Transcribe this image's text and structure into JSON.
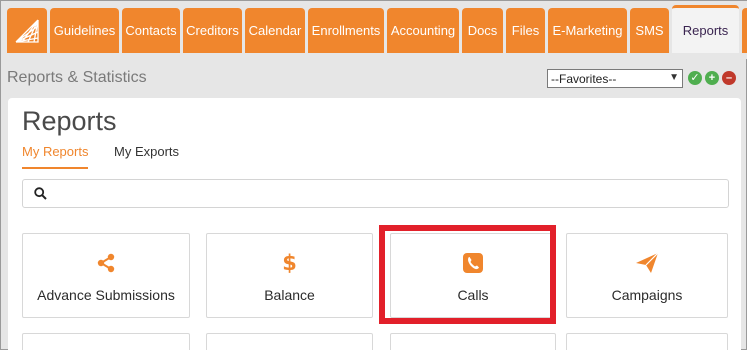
{
  "nav": {
    "tabs": [
      {
        "label": "Guidelines"
      },
      {
        "label": "Contacts"
      },
      {
        "label": "Creditors"
      },
      {
        "label": "Calendar"
      },
      {
        "label": "Enrollments"
      },
      {
        "label": "Accounting"
      },
      {
        "label": "Docs"
      },
      {
        "label": "Files"
      },
      {
        "label": "E-Marketing"
      },
      {
        "label": "SMS"
      },
      {
        "label": "Reports"
      }
    ],
    "active_tab": "Reports",
    "logo_icon": "logo-grid-icon",
    "tab_color": "#f0862d"
  },
  "subheader": {
    "title": "Reports & Statistics",
    "favorites_selected": "--Favorites--",
    "icons": [
      "check-circle-icon",
      "plus-circle-icon",
      "minus-circle-icon"
    ]
  },
  "panel": {
    "title": "Reports",
    "subtabs": [
      {
        "label": "My Reports",
        "active": true
      },
      {
        "label": "My Exports",
        "active": false
      }
    ],
    "search": {
      "placeholder": "",
      "value": ""
    },
    "cards": [
      {
        "label": "Advance Submissions",
        "icon": "share-icon"
      },
      {
        "label": "Balance",
        "icon": "dollar-icon"
      },
      {
        "label": "Calls",
        "icon": "phone-icon"
      },
      {
        "label": "Campaigns",
        "icon": "paper-plane-icon"
      }
    ]
  },
  "colors": {
    "accent": "#f0862d",
    "highlight": "#e2202a",
    "active_tab_text": "#3a2450"
  }
}
